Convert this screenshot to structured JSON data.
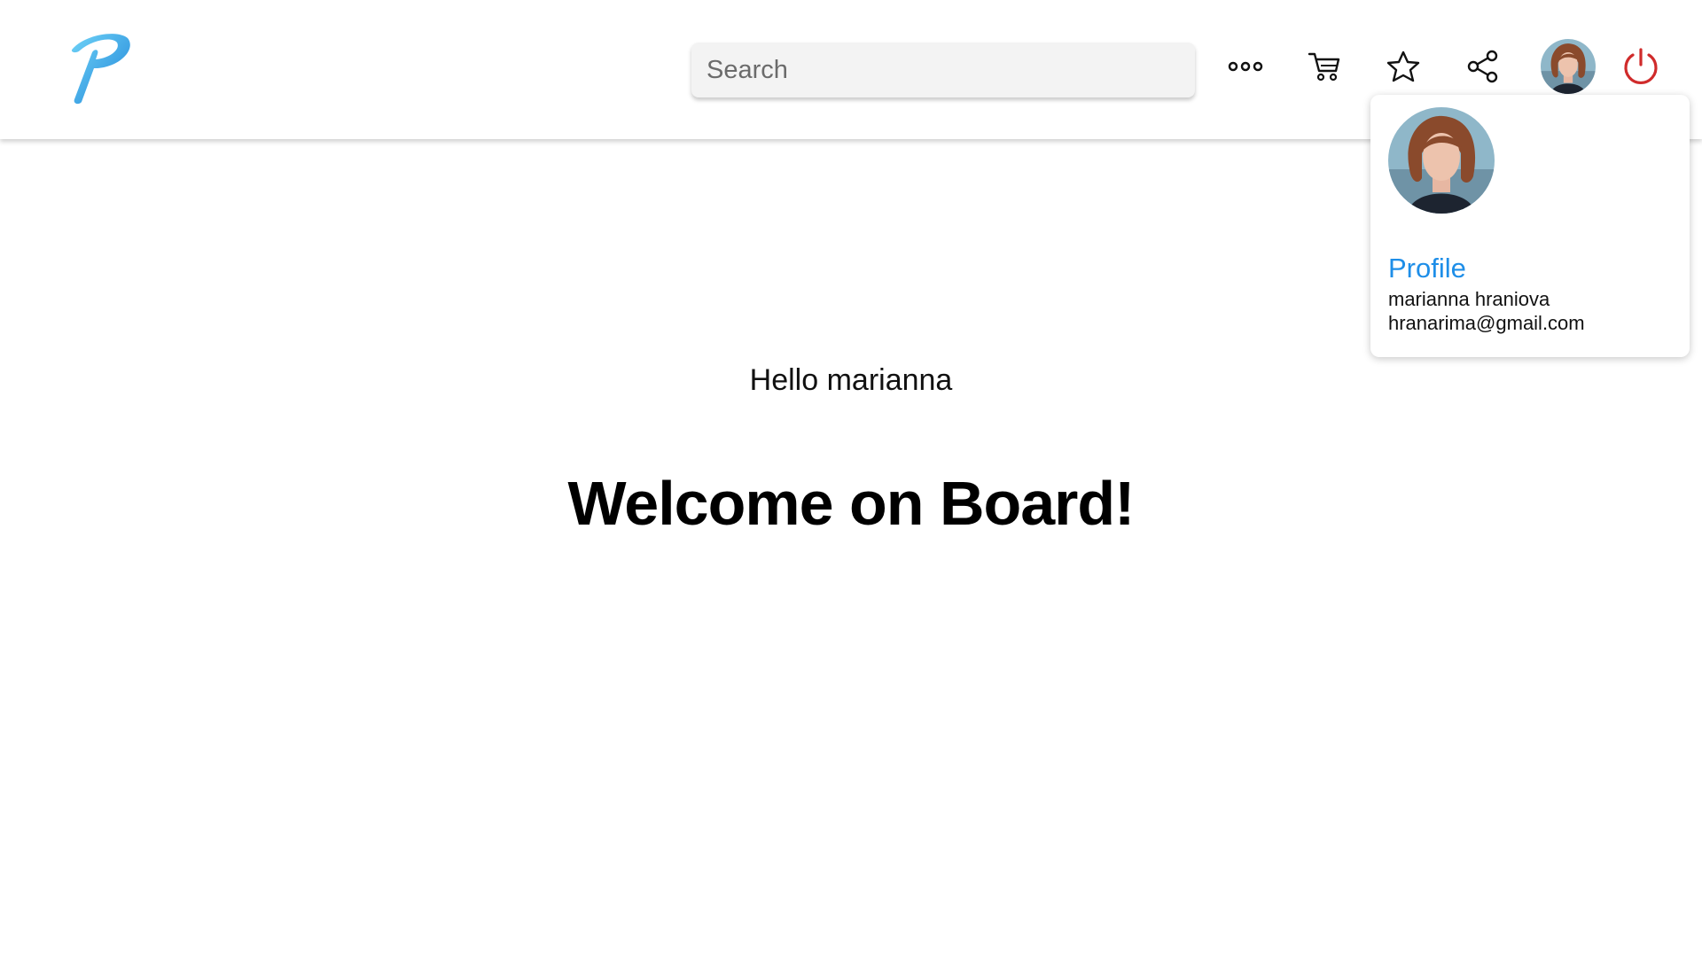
{
  "header": {
    "logo_icon": "brand-p-logo-icon",
    "search_placeholder": "Search",
    "search_value": "",
    "icons": {
      "more": "more-horizontal-icon",
      "cart": "cart-icon",
      "favorites": "star-icon",
      "share": "share-icon",
      "power": "power-icon"
    }
  },
  "profile_menu": {
    "link_label": "Profile",
    "name": "marianna hraniova",
    "email": "hranarima@gmail.com"
  },
  "main": {
    "greeting": "Hello marianna",
    "headline": "Welcome on Board!"
  },
  "colors": {
    "brand_blue": "#1e8ee8",
    "power_red": "#d02b2b",
    "search_bg": "#f3f3f3"
  }
}
